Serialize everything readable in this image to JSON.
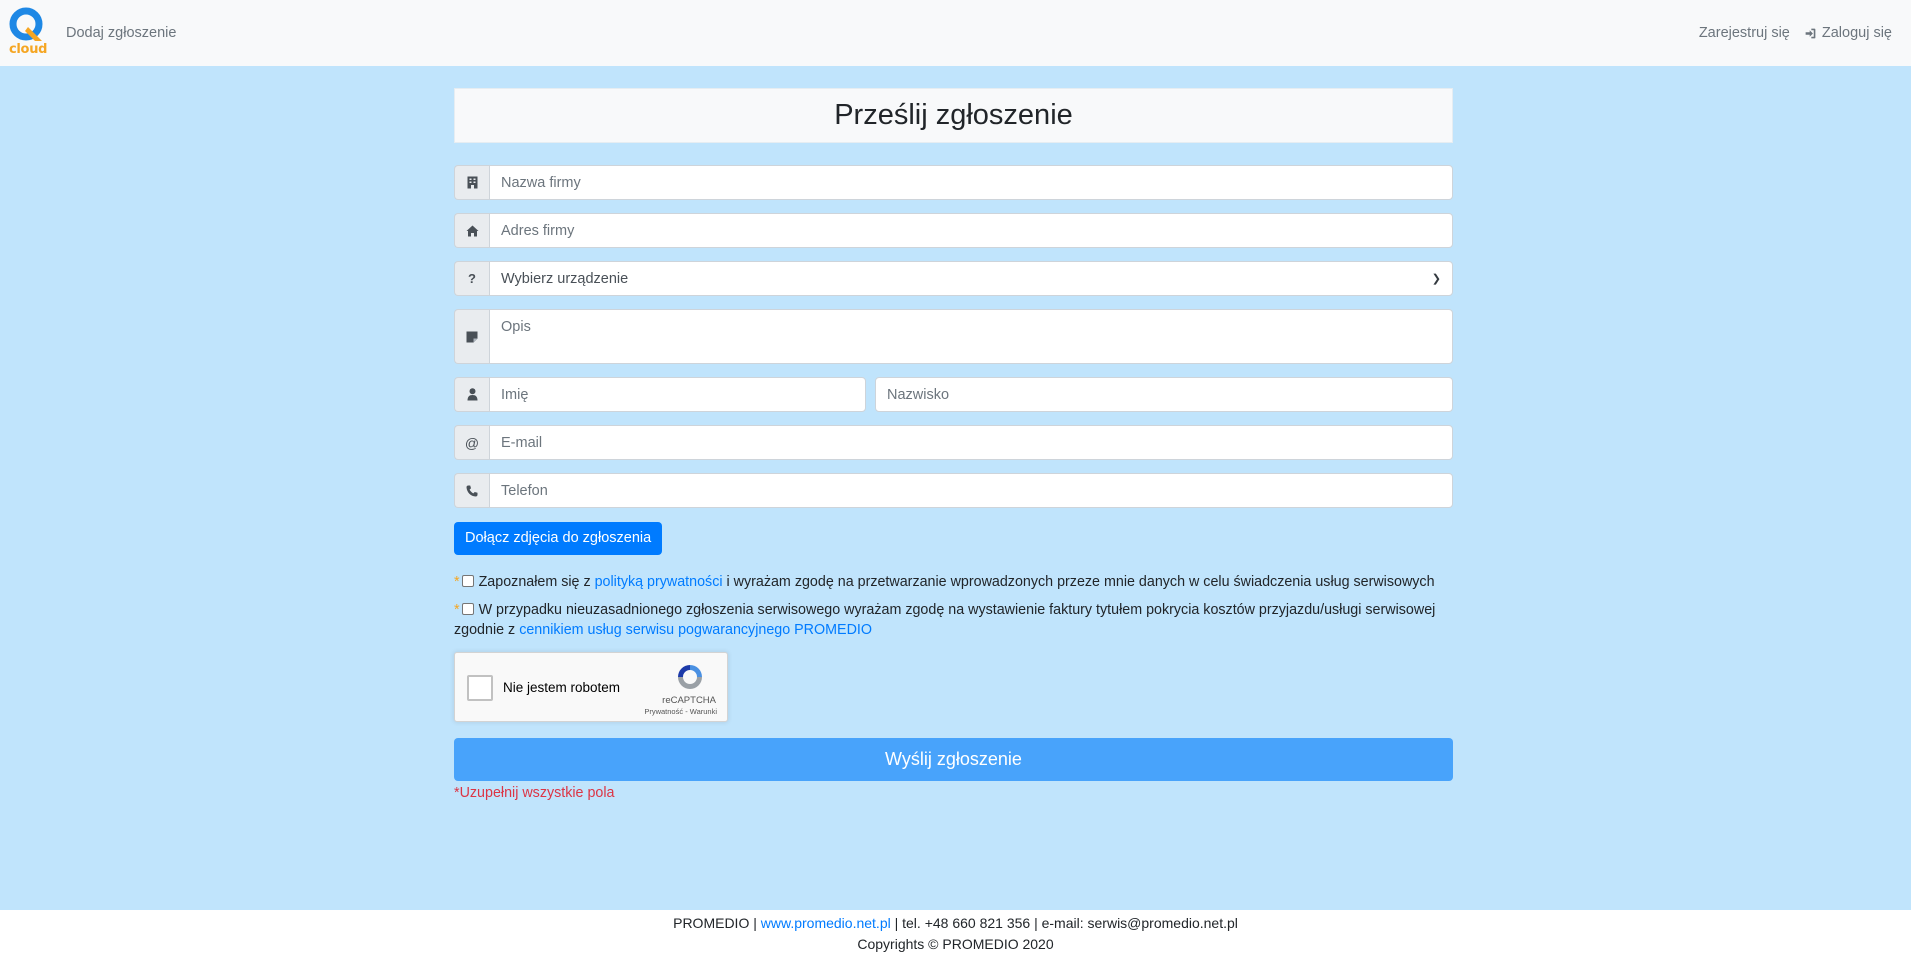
{
  "navbar": {
    "logo_text": "cloud",
    "add_ticket": "Dodaj zgłoszenie",
    "register": "Zarejestruj się",
    "login": "Zaloguj się"
  },
  "form": {
    "title": "Prześlij zgłoszenie",
    "company_name_placeholder": "Nazwa firmy",
    "company_address_placeholder": "Adres firmy",
    "device_select_value": "Wybierz urządzenie",
    "description_placeholder": "Opis",
    "first_name_placeholder": "Imię",
    "last_name_placeholder": "Nazwisko",
    "email_placeholder": "E-mail",
    "phone_placeholder": "Telefon",
    "email_prefix": "@",
    "attach_photos": "Dołącz zdjęcia do zgłoszenia",
    "consent1": {
      "asterisk": "*",
      "before": "Zapoznałem się z ",
      "link": "polityką prywatności",
      "after": " i wyrażam zgodę na przetwarzanie wprowadzonych przeze mnie danych w celu świadczenia usług serwisowych"
    },
    "consent2": {
      "asterisk": "*",
      "before": "W przypadku nieuzasadnionego zgłoszenia serwisowego wyrażam zgodę na wystawienie faktury tytułem pokrycia kosztów przyjazdu/usługi serwisowej zgodnie z ",
      "link": "cennikiem usług serwisu pogwarancyjnego PROMEDIO"
    },
    "recaptcha": {
      "label": "Nie jestem robotem",
      "brand": "reCAPTCHA",
      "terms": "Prywatność - Warunki"
    },
    "submit": "Wyślij zgłoszenie",
    "error": "*Uzupełnij wszystkie pola"
  },
  "footer": {
    "company": "PROMEDIO | ",
    "website": "www.promedio.net.pl",
    "contact": " | tel. +48 660 821 356 | e-mail: serwis@promedio.net.pl",
    "copyright": "Copyrights © PROMEDIO 2020"
  },
  "colors": {
    "page_bg": "#c0e4fc",
    "primary": "#007bff",
    "submit": "#48a3fb",
    "error": "#dc3545",
    "logo_blue": "#1e88e5",
    "logo_orange": "#f5a623"
  }
}
